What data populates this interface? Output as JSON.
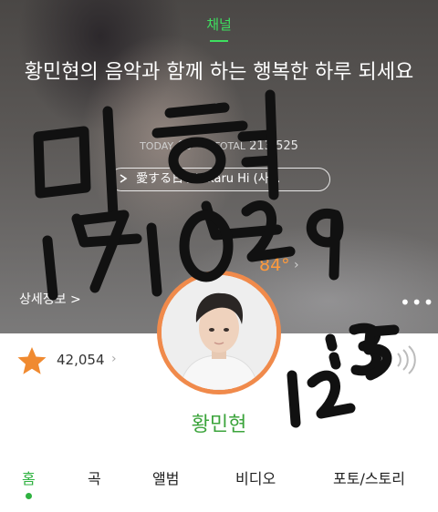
{
  "header": {
    "tag": "채널",
    "title": "황민현의 음악과 함께 하는 행복한 하루 되세요~"
  },
  "stats": {
    "today_label": "TODAY",
    "today_value": "65",
    "total_label": "TOTAL",
    "total_value": "213,525"
  },
  "music": {
    "play_icon": "play-icon",
    "text": "愛する日 / Hikaru Hi (사..."
  },
  "temperature": {
    "value": "84°"
  },
  "details": {
    "label": "상세정보 >"
  },
  "likes": {
    "count": "42,054"
  },
  "profile": {
    "name": "황민현"
  },
  "tabs": [
    {
      "label": "홈",
      "active": true
    },
    {
      "label": "곡",
      "active": false
    },
    {
      "label": "앨범",
      "active": false
    },
    {
      "label": "비디오",
      "active": false
    },
    {
      "label": "포토/스토리",
      "active": false
    }
  ],
  "handwriting": {
    "lines": [
      "민현",
      "171029",
      "12:35"
    ]
  },
  "colors": {
    "accent_green": "#2fb240",
    "temp_orange": "#ff9a3c",
    "star_orange": "#f08a30",
    "ring_orange": "#f08a4b"
  }
}
